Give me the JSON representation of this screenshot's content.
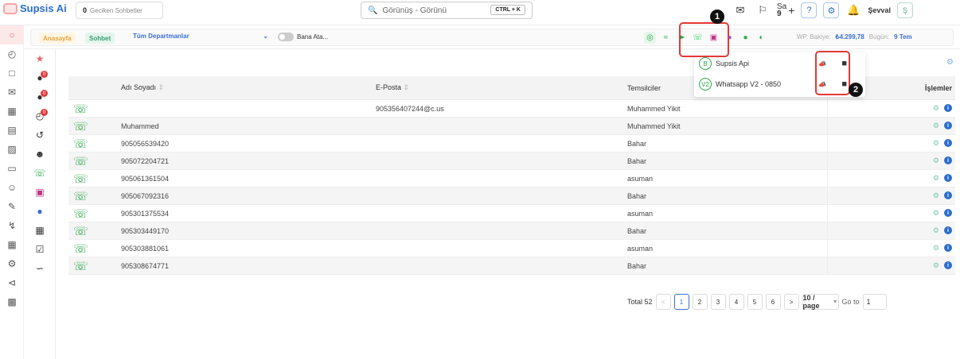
{
  "app": {
    "name": "Supsis Ai"
  },
  "topbar": {
    "late_count": "0",
    "late_label": "Geciken Sohbetler",
    "search_placeholder": "Görünüş - Görünü",
    "search_shortcut": "CTRL + K",
    "sa_label": "Sa",
    "sa_count": "9",
    "user_name": "Şevval",
    "avatar_initial": "Ş"
  },
  "subbar": {
    "home": "Anasayfa",
    "chat": "Sohbet",
    "department": "Tüm Departmanlar",
    "toggle_label": "Bana Ata...",
    "wp_balance_label": "WP. Bakiye:",
    "wp_balance_value": "₺4.299,78",
    "today_label": "Bugün:",
    "today_value": "9 Tem"
  },
  "dropdown": {
    "items": [
      {
        "icon": "B",
        "label": "Supsis Api"
      },
      {
        "icon": "V2",
        "label": "Whatsapp V2 - 0850"
      }
    ]
  },
  "annotations": {
    "badge1": "1",
    "badge2": "2"
  },
  "table": {
    "headers": {
      "name": "Adı Soyadı",
      "email": "E-Posta",
      "rep": "Temsilciler",
      "actions": "İşlemler"
    },
    "rows": [
      {
        "name": "",
        "email": "905356407244@c.us",
        "rep": "Muhammed Yikit"
      },
      {
        "name": "Muhammed",
        "email": "",
        "rep": "Muhammed Yikit"
      },
      {
        "name": "905056539420",
        "email": "",
        "rep": "Bahar"
      },
      {
        "name": "905072204721",
        "email": "",
        "rep": "Bahar"
      },
      {
        "name": "905061361504",
        "email": "",
        "rep": "asuman"
      },
      {
        "name": "905067092316",
        "email": "",
        "rep": "Bahar"
      },
      {
        "name": "905301375534",
        "email": "",
        "rep": "asuman"
      },
      {
        "name": "905303449170",
        "email": "",
        "rep": "Bahar"
      },
      {
        "name": "905303881061",
        "email": "",
        "rep": "asuman"
      },
      {
        "name": "905308674771",
        "email": "",
        "rep": "Bahar"
      }
    ]
  },
  "pagination": {
    "total": "Total 52",
    "pages": [
      "1",
      "2",
      "3",
      "4",
      "5",
      "6"
    ],
    "current_page": "1",
    "page_size": "10 / page",
    "goto_label": "Go to",
    "goto_value": "1"
  },
  "colors": {
    "accent": "#2c6ecb",
    "whatsapp": "#2aa84a",
    "highlight": "#e53935"
  }
}
